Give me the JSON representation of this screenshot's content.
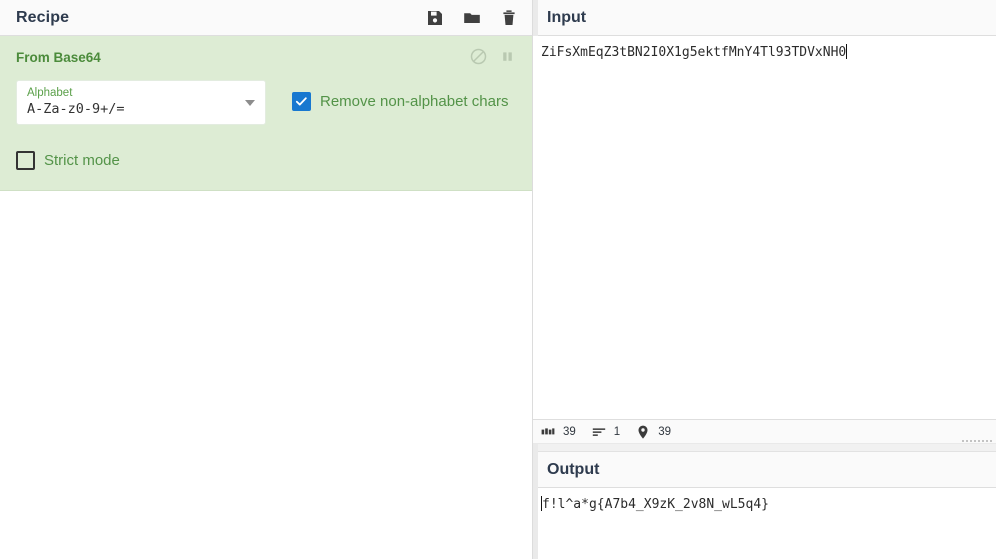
{
  "recipe": {
    "title": "Recipe",
    "toolbar": [
      {
        "name": "save-recipe-icon",
        "label": "Save recipe"
      },
      {
        "name": "load-recipe-icon",
        "label": "Load recipe"
      },
      {
        "name": "clear-recipe-icon",
        "label": "Clear recipe"
      }
    ],
    "operations": [
      {
        "name": "From Base64",
        "controls": [
          {
            "name": "disable-operation-icon",
            "label": "Disable operation"
          },
          {
            "name": "set-breakpoint-icon",
            "label": "Set breakpoint"
          }
        ],
        "args": {
          "alphabet_label": "Alphabet",
          "alphabet_value": "A-Za-z0-9+/=",
          "remove_non_alphabet_label": "Remove non-alphabet chars",
          "remove_non_alphabet_checked": true,
          "strict_mode_label": "Strict mode",
          "strict_mode_checked": false
        }
      }
    ]
  },
  "input": {
    "title": "Input",
    "value": "ZiFsXmEqZ3tBN2I0X1g5ektfMnY4Tl93TDVxNH0",
    "status": {
      "length_icon": "character-count-icon",
      "length": "39",
      "lines_icon": "line-count-icon",
      "lines": "1",
      "position_icon": "cursor-position-icon",
      "position": "39"
    }
  },
  "output": {
    "title": "Output",
    "value": "f!l^a*g{A7b4_X9zK_2v8N_wL5q4}"
  },
  "colors": {
    "operation_bg": "#ddecd4",
    "operation_title": "#4b8b3b",
    "arg_label": "#5ba04a",
    "arg_text": "#539348",
    "checkbox_on": "#1878d0",
    "pane_title": "#2e3b4e",
    "titlebar_bg": "#fafafa"
  }
}
